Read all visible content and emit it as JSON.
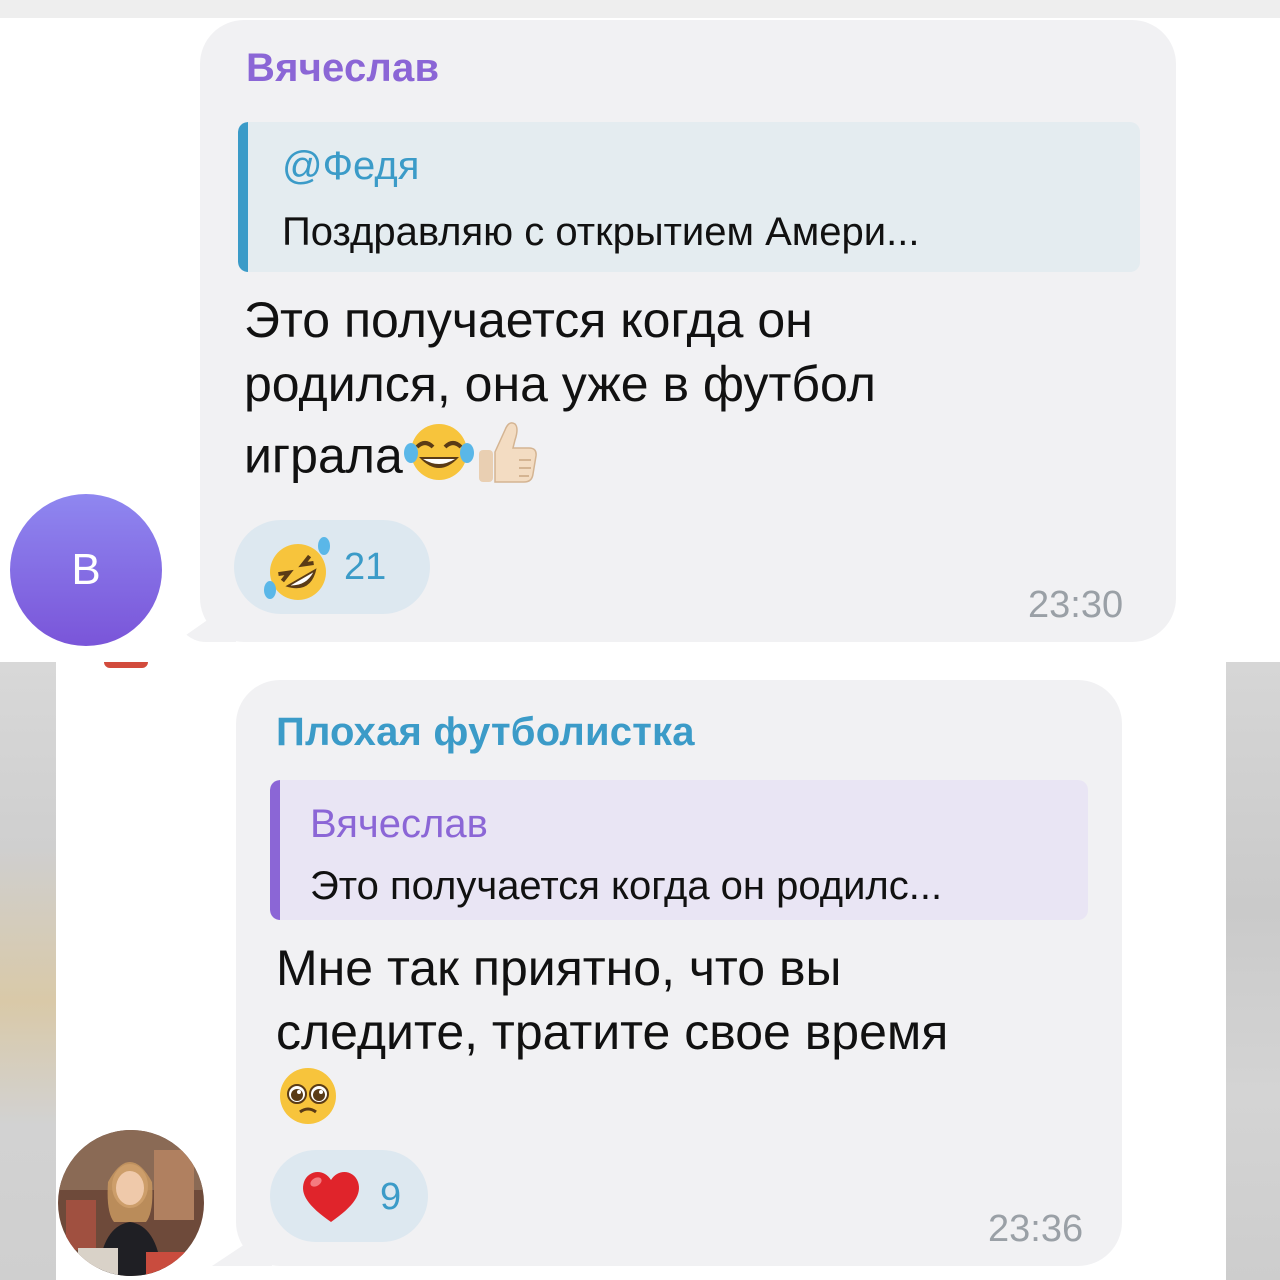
{
  "messages": [
    {
      "sender": "Вячеслав",
      "avatar_letter": "В",
      "reply": {
        "name": "@Федя",
        "text": "Поздравляю с открытием Амери..."
      },
      "text_lines": [
        "Это получается когда он",
        "родился, она уже в футбол",
        "играла"
      ],
      "trailing_emojis": [
        "face-with-tears-of-joy",
        "thumbs-up-light-skin"
      ],
      "reaction": {
        "emoji": "rolling-on-floor-laughing",
        "count": "21"
      },
      "time": "23:30"
    },
    {
      "sender": "Плохая футболистка",
      "avatar": "photo",
      "reply": {
        "name": "Вячеслав",
        "text": "Это получается когда он родилс..."
      },
      "text_lines": [
        "Мне так приятно, что вы",
        "следите, тратите свое время"
      ],
      "trailing_emojis": [
        "pleading-face"
      ],
      "reaction": {
        "emoji": "red-heart",
        "count": "9"
      },
      "time": "23:36"
    }
  ],
  "colors": {
    "bubble": "#f1f1f3",
    "purple_name": "#8b66d6",
    "blue_name": "#3b9bc8",
    "time": "#9aa0a6"
  }
}
